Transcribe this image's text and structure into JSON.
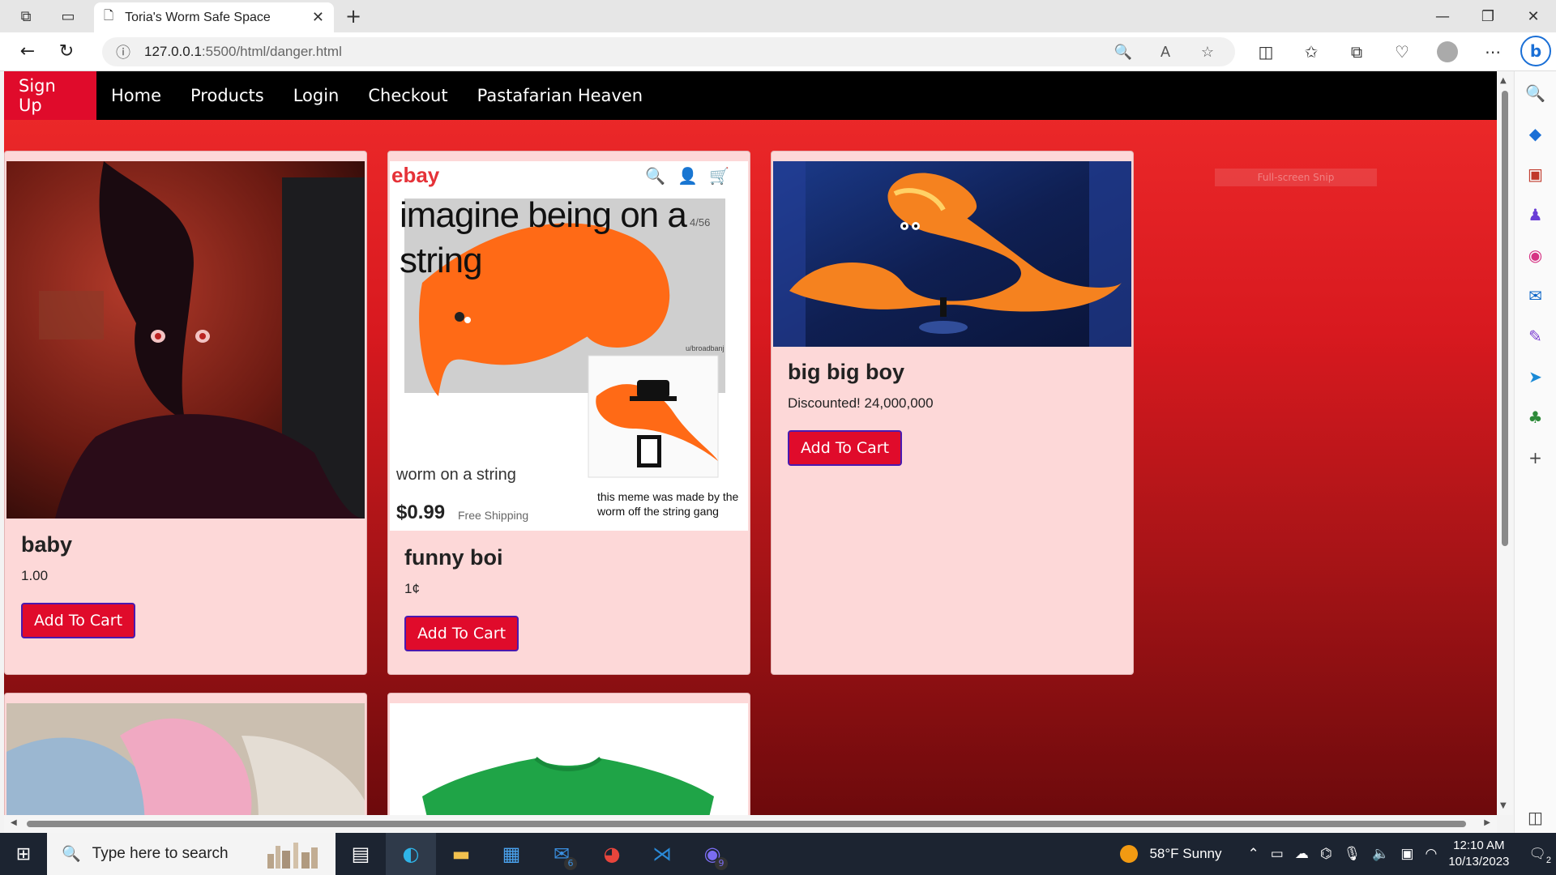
{
  "browser": {
    "tab_title": "Toria's Worm Safe Space",
    "url_host": "127.0.0.1",
    "url_path": ":5500/html/danger.html"
  },
  "nav": {
    "items": [
      "Sign Up",
      "Home",
      "Products",
      "Login",
      "Checkout",
      "Pastafarian Heaven"
    ]
  },
  "products": [
    {
      "name": "baby",
      "price": "1.00",
      "button": "Add To Cart"
    },
    {
      "name": "funny boi",
      "price": "1¢",
      "button": "Add To Cart"
    },
    {
      "name": "big big boy",
      "price": "Discounted! 24,000,000",
      "button": "Add To Cart"
    }
  ],
  "meme": {
    "brand": "ebay",
    "headline1": "imagine being on a",
    "headline2": "string",
    "counter": "4/56",
    "caption": "worm on a string",
    "price": "$0.99",
    "shipping": "Free Shipping",
    "credit1": "this meme was made by the",
    "credit2": "worm off the string gang",
    "watermark": "u/broadbanj"
  },
  "snip_label": "Full-screen Snip",
  "taskbar": {
    "search_placeholder": "Type here to search",
    "mail_badge": "6",
    "discord_badge": "9",
    "weather": "58°F  Sunny",
    "time": "12:10 AM",
    "date": "10/13/2023",
    "notif_count": "2"
  }
}
